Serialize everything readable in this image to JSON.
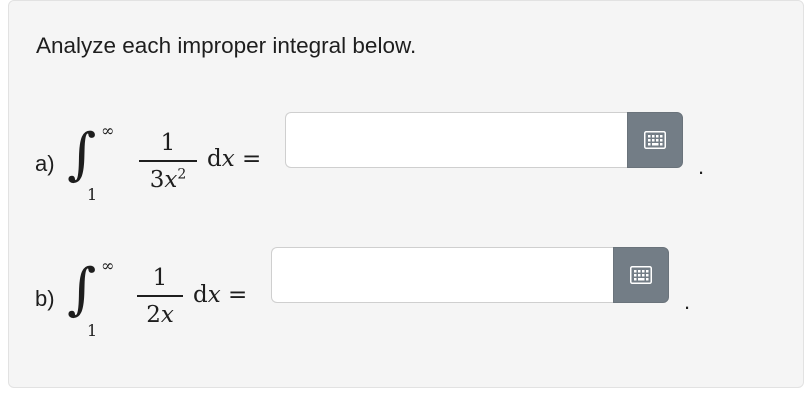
{
  "prompt": "Analyze each improper integral below.",
  "parts": [
    {
      "label": "a)",
      "integral": {
        "upper": "∞",
        "lower": "1",
        "numerator": "1",
        "denominator_coef": "3",
        "denominator_var": "x",
        "denominator_exp": "2",
        "differential_d": "d",
        "differential_var": "x",
        "equals": "="
      },
      "answer": {
        "value": "",
        "placeholder": ""
      },
      "keypad_icon": "keypad-icon",
      "trailing": "."
    },
    {
      "label": "b)",
      "integral": {
        "upper": "∞",
        "lower": "1",
        "numerator": "1",
        "denominator_coef": "2",
        "denominator_var": "x",
        "denominator_exp": "",
        "differential_d": "d",
        "differential_var": "x",
        "equals": "="
      },
      "answer": {
        "value": "",
        "placeholder": ""
      },
      "keypad_icon": "keypad-icon",
      "trailing": "."
    }
  ],
  "colors": {
    "panel_bg": "#f5f5f5",
    "keypad_bg": "#737d86",
    "text": "#1e1e1e"
  }
}
